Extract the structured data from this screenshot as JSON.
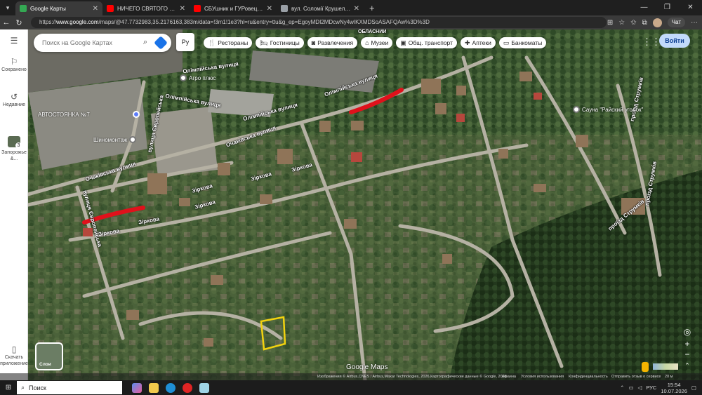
{
  "tabs": [
    {
      "title": "Google Карты",
      "active": true,
      "favicon_color": "#34a853"
    },
    {
      "title": "НИЧЕГО СВЯТОГО с Сергеем По...",
      "active": false,
      "favicon_color": "#ff0000"
    },
    {
      "title": "СБУшник и ГУРовец застрелили...",
      "active": false,
      "favicon_color": "#ff0000"
    },
    {
      "title": "вул. Соломії Крушельницької (Ч...",
      "active": false,
      "favicon_color": "#9aa0a6"
    }
  ],
  "tab_close": "✕",
  "new_tab": "+",
  "window_controls": {
    "minimize": "—",
    "maximize": "❐",
    "close": "✕"
  },
  "url": {
    "prefix": "https://",
    "host": "www.google.com",
    "path": "/maps/@47.7732983,35.2176163,383m/data=!3m1!1e3?hl=ru&entry=ttu&g_ep=EgoyMDI2MDcwNy4wIKXMDSoASAFQAw%3D%3D"
  },
  "chat_label": "Чат",
  "sidebar": [
    {
      "label": "Сохранено",
      "icon": "bookmark-icon"
    },
    {
      "label": "Недавние",
      "icon": "history-icon"
    },
    {
      "label": "Запорожье &...",
      "icon": "recent-map-thumb",
      "badge": "3"
    },
    {
      "label": "Скачать приложение",
      "icon": "phone-icon"
    }
  ],
  "search": {
    "placeholder": "Поиск на Google Картах"
  },
  "language_selector": "Ру",
  "chips": [
    {
      "label": "Рестораны",
      "icon": "restaurant-icon"
    },
    {
      "label": "Гостиницы",
      "icon": "hotel-icon"
    },
    {
      "label": "Развлечения",
      "icon": "camera-icon"
    },
    {
      "label": "Музеи",
      "icon": "museum-icon"
    },
    {
      "label": "Общ. транспорт",
      "icon": "transit-icon"
    },
    {
      "label": "Аптеки",
      "icon": "pharmacy-icon"
    },
    {
      "label": "Банкоматы",
      "icon": "atm-icon"
    }
  ],
  "login_button": "Войти",
  "streets": {
    "olimpiyska_1": "Олімпійська вулиця",
    "olimpiyska_2": "Олімпійська вулиця",
    "olimpiyska_3": "Олімпійська вулиця",
    "ochakivska_1": "Очаківська вулиця",
    "ochakivska_2": "Очаківська вулиця",
    "yevropeiska": "вулиця Європейська",
    "zirkova_1": "Зіркова",
    "zirkova_2": "Зіркова",
    "zirkova_3": "Зіркова",
    "zirkova_4": "Зіркова",
    "zirkova_5": "Зіркова",
    "strumka_1": "проїзд Струмків",
    "strumka_2": "проїзд Струмків",
    "oblasnyi": "ОБЛАСНИЙ"
  },
  "pois": {
    "agroplus": "Агро плюс",
    "autostoyanka": "АВТОСТОЯНКА №7",
    "shinomontazh": "Шиномонтаж",
    "sauna": "Сауна \"Райский уголок\""
  },
  "layers_label": "Слои",
  "google_maps_logo": "Google Maps",
  "attribution": {
    "imagery": "Изображения © Airbus,CNES / Airbus,Maxar Technologies, 2026,Картографические данные © Google, 2026",
    "country": "Украина",
    "terms": "Условия использования",
    "privacy": "Конфиденциальность",
    "feedback": "Отправить отзыв о сервисе",
    "scale": "20 м"
  },
  "taskbar": {
    "search_label": "Поиск",
    "lang": "РУС",
    "time": "15:54",
    "date": "10.07.2026"
  },
  "colors": {
    "highlight_red": "#e0111b",
    "highlight_yellow": "#f2d20f",
    "accent_blue": "#1a73e8"
  }
}
